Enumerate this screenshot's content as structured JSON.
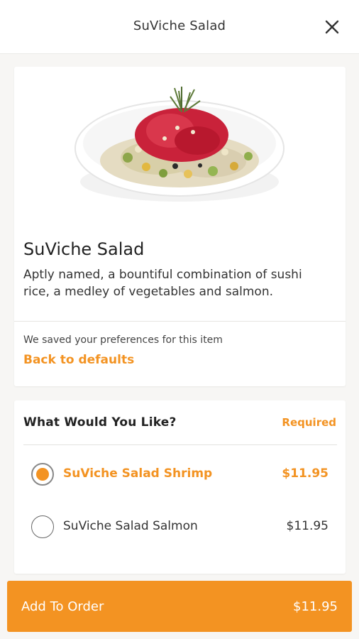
{
  "header": {
    "title": "SuViche Salad",
    "close_icon": "close-icon"
  },
  "item": {
    "title": "SuViche Salad",
    "description": "Aptly named, a bountiful combination of sushi rice, a medley of vegetables and salmon.",
    "saved_note": "We saved your preferences for this item",
    "back_to_defaults": "Back to defaults"
  },
  "options": {
    "heading": "What Would You Like?",
    "required_label": "Required",
    "choices": [
      {
        "label": "SuViche Salad Shrimp",
        "price": "$11.95",
        "selected": true
      },
      {
        "label": "SuViche Salad Salmon",
        "price": "$11.95",
        "selected": false
      }
    ]
  },
  "cta": {
    "label": "Add To Order",
    "price": "$11.95"
  },
  "colors": {
    "accent": "#f39322",
    "background": "#f7f6f4"
  }
}
